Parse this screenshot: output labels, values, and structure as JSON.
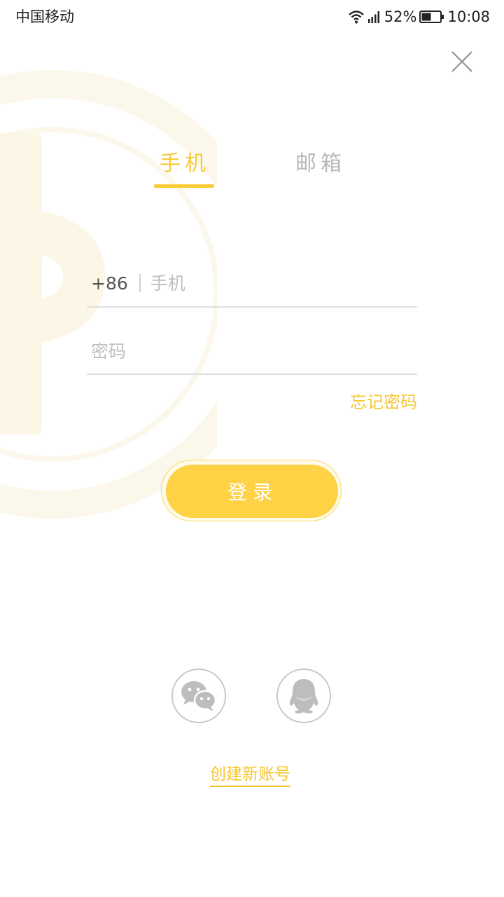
{
  "status_bar": {
    "carrier": "中国移动",
    "battery_percent": "52%",
    "time": "10:08",
    "battery_level": 0.52,
    "icons": [
      "wifi-icon",
      "signal-icon",
      "battery-icon"
    ]
  },
  "tabs": [
    {
      "label": "手机",
      "active": true
    },
    {
      "label": "邮箱",
      "active": false
    }
  ],
  "form": {
    "country_code": "+86",
    "phone_placeholder": "手机",
    "phone_value": "",
    "password_placeholder": "密码",
    "password_value": "",
    "forgot_label": "忘记密码"
  },
  "login": {
    "label": "登录"
  },
  "social": [
    {
      "icon": "wechat-icon"
    },
    {
      "icon": "qq-icon"
    }
  ],
  "footer": {
    "create_account_label": "创建新账号"
  },
  "colors": {
    "accent": "#f9c93a",
    "button": "#ffd246",
    "inactive_tab": "#b8b8b8",
    "divider": "#dedede",
    "social_icon": "#bdbdbd"
  }
}
